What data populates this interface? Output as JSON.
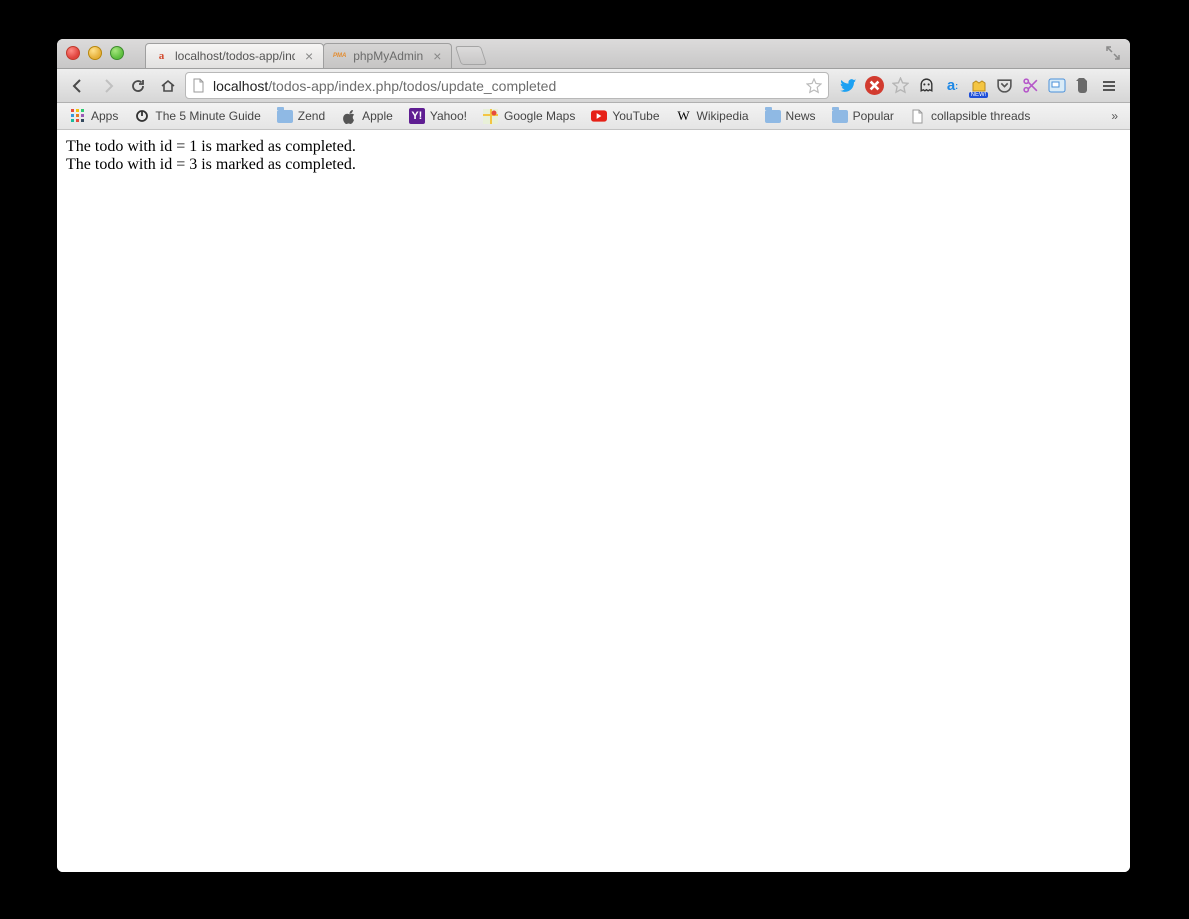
{
  "tabs": [
    {
      "title": "localhost/todos-app/index",
      "favicon_letter": "a",
      "favicon_color": "#d24b2f",
      "active": true
    },
    {
      "title": "phpMyAdmin",
      "favicon_letter": "PMA",
      "favicon_color": "#e48b2e",
      "active": false
    }
  ],
  "url": {
    "host": "localhost",
    "path": "/todos-app/index.php/todos/update_completed"
  },
  "bookmarks": [
    {
      "label": "Apps",
      "icon": "apps"
    },
    {
      "label": "The 5 Minute Guide",
      "icon": "power"
    },
    {
      "label": "Zend",
      "icon": "folder"
    },
    {
      "label": "Apple",
      "icon": "apple"
    },
    {
      "label": "Yahoo!",
      "icon": "yahoo"
    },
    {
      "label": "Google Maps",
      "icon": "gmaps"
    },
    {
      "label": "YouTube",
      "icon": "youtube"
    },
    {
      "label": "Wikipedia",
      "icon": "wikipedia"
    },
    {
      "label": "News",
      "icon": "folder"
    },
    {
      "label": "Popular",
      "icon": "folder"
    },
    {
      "label": "collapsible threads",
      "icon": "page"
    }
  ],
  "page_lines": [
    "The todo with id = 1 is marked as completed.",
    "The todo with id = 3 is marked as completed."
  ],
  "ext_icons": [
    {
      "name": "twitter-icon",
      "color": "#1da1f2",
      "glyph": "tw"
    },
    {
      "name": "adblock-icon",
      "color": "#d23b2f",
      "glyph": "ab"
    },
    {
      "name": "star-icon",
      "color": "#bcbcbc",
      "glyph": "star"
    },
    {
      "name": "privacy-icon",
      "color": "#444",
      "glyph": "ghost"
    },
    {
      "name": "alexa-icon",
      "color": "#1e88e5",
      "glyph": "a"
    },
    {
      "name": "new-badge-icon",
      "color": "#1e4fd8",
      "glyph": "new"
    },
    {
      "name": "pocket-icon",
      "color": "#555",
      "glyph": "pocket"
    },
    {
      "name": "scissors-icon",
      "color": "#b556c9",
      "glyph": "cut"
    },
    {
      "name": "screenshot-icon",
      "color": "#4a90d9",
      "glyph": "rect"
    },
    {
      "name": "evernote-icon",
      "color": "#6fbf4b",
      "glyph": "ev"
    }
  ]
}
